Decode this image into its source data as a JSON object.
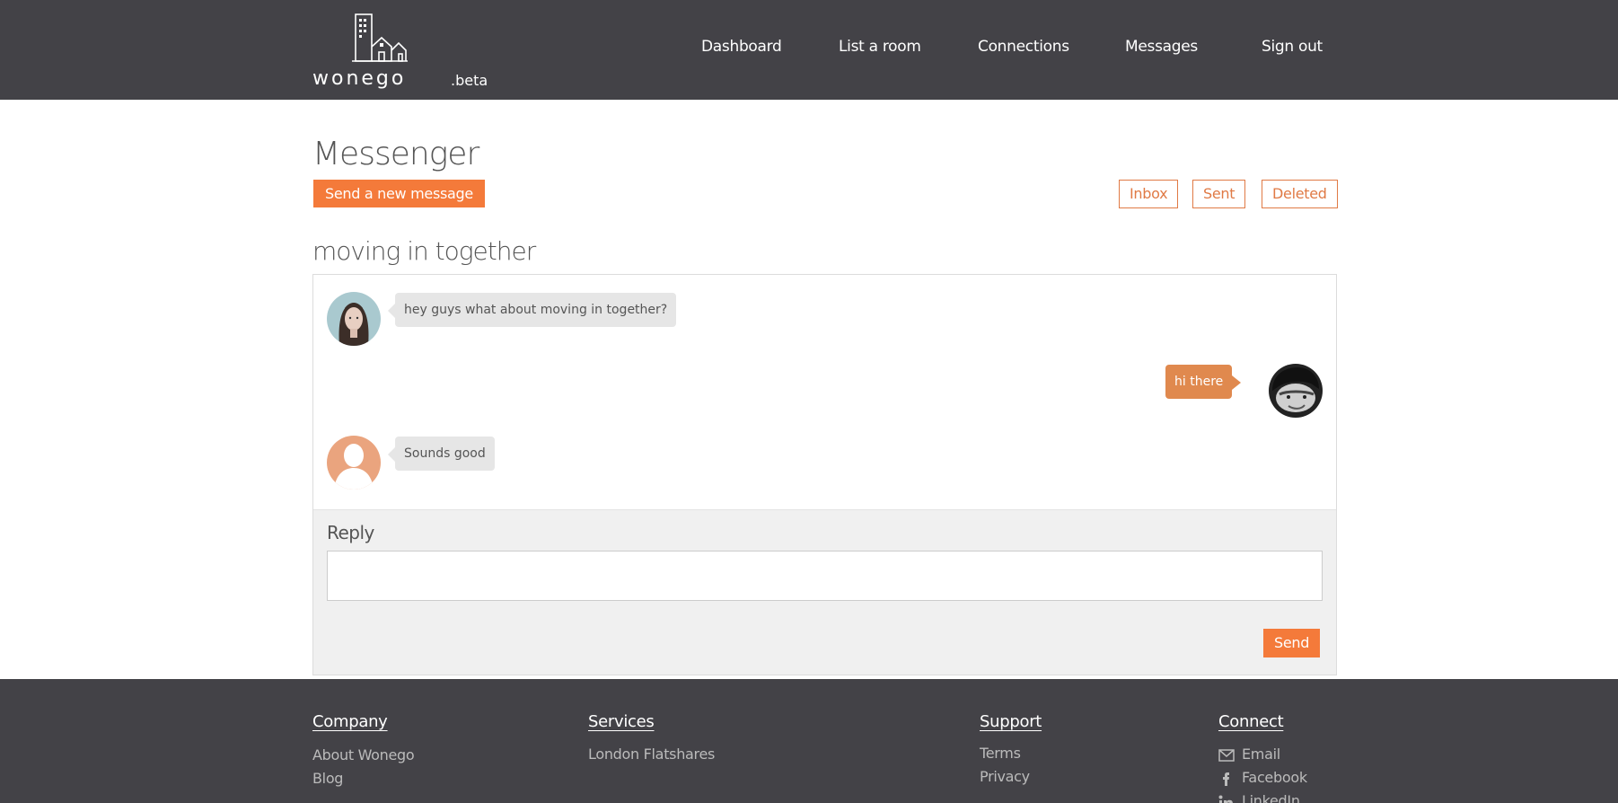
{
  "header": {
    "logo_text": "wonego",
    "logo_suffix": ".beta",
    "nav": [
      {
        "label": "Dashboard"
      },
      {
        "label": "List a room"
      },
      {
        "label": "Connections"
      },
      {
        "label": "Messages"
      },
      {
        "label": "Sign out"
      }
    ]
  },
  "page": {
    "title": "Messenger",
    "new_message_label": "Send a new message",
    "folders": [
      {
        "label": "Inbox"
      },
      {
        "label": "Sent"
      },
      {
        "label": "Deleted"
      }
    ]
  },
  "thread": {
    "subject": "moving in together",
    "messages": [
      {
        "direction": "incoming",
        "text": "hey guys what about moving in together?",
        "avatar": "female-photo"
      },
      {
        "direction": "outgoing",
        "text": "hi there",
        "avatar": "male-photo"
      },
      {
        "direction": "incoming",
        "text": "Sounds good",
        "avatar": "default-silhouette"
      }
    ],
    "reply_label": "Reply",
    "reply_value": "",
    "send_label": "Send"
  },
  "footer": {
    "company": {
      "heading": "Company",
      "links": [
        "About Wonego",
        "Blog"
      ]
    },
    "services": {
      "heading": "Services",
      "links": [
        "London Flatshares"
      ]
    },
    "support": {
      "heading": "Support",
      "links": [
        "Terms",
        "Privacy"
      ]
    },
    "connect": {
      "heading": "Connect",
      "links": [
        {
          "label": "Email",
          "icon": "envelope-icon"
        },
        {
          "label": "Facebook",
          "icon": "facebook-icon"
        },
        {
          "label": "LinkedIn",
          "icon": "linkedin-icon"
        }
      ]
    }
  },
  "colors": {
    "header_bg": "#434247",
    "accent": "#f47a3a",
    "outgoing_bubble": "#e0894e",
    "incoming_bubble": "#e6e6e6",
    "reply_bg": "#f0f0f0"
  }
}
